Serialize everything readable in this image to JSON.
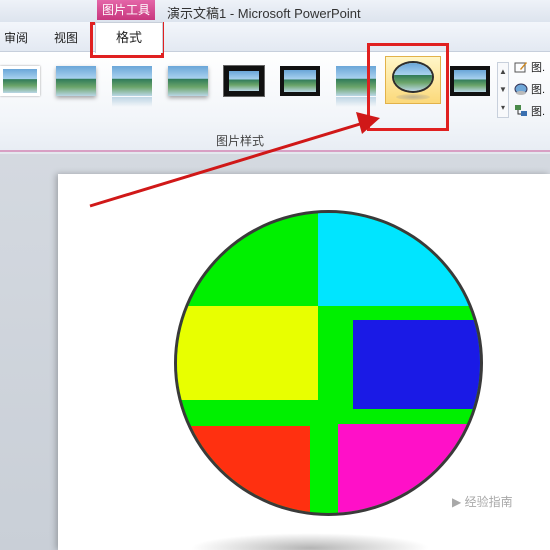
{
  "title_bar": {
    "context_tab": "图片工具",
    "document_title": "演示文稿1  -  Microsoft PowerPoint"
  },
  "tabs": [
    {
      "label": "审阅"
    },
    {
      "label": "视图"
    }
  ],
  "active_tab": "格式",
  "ribbon": {
    "group_label": "图片样式",
    "side_commands": [
      {
        "label": "图.",
        "icon": "picture-border-icon"
      },
      {
        "label": "图.",
        "icon": "picture-effects-icon"
      },
      {
        "label": "图.",
        "icon": "picture-layout-icon"
      }
    ],
    "gallery_styles": [
      "simple-frame-white",
      "soft-edge",
      "reflected",
      "soft-shadow",
      "thick-matte-black",
      "black-frame",
      "simple-frame-black",
      "reflected-bevel-oval-selected",
      "double-frame-black"
    ]
  },
  "slide": {
    "picture": {
      "colors": {
        "background": "#00f000",
        "cyan": "#00e5ff",
        "yellow": "#e8ff00",
        "blue": "#1a1ae6",
        "red": "#ff3010",
        "magenta": "#ff10c8",
        "border": "#3a3a3a"
      }
    }
  },
  "annotations": {
    "highlight_color": "#e02020"
  },
  "watermark": "▶ 经验指南"
}
